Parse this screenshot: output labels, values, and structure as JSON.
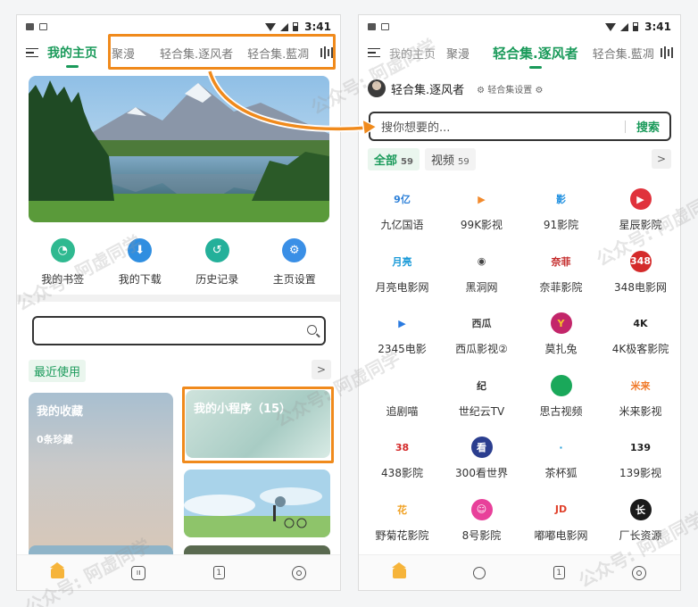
{
  "status": {
    "time": "3:41"
  },
  "nav": {
    "tabs_left": [
      "我的主页",
      "聚漫",
      "轻合集.逐风者",
      "轻合集.藍凋"
    ],
    "tabs_right": [
      "我的主页",
      "聚漫",
      "轻合集.逐风者",
      "轻合集.藍凋"
    ]
  },
  "home": {
    "quick_actions": [
      {
        "label": "我的书签",
        "icon": "bookmark-icon",
        "color": "#2fb990"
      },
      {
        "label": "我的下载",
        "icon": "download-icon",
        "color": "#2f8ee0"
      },
      {
        "label": "历史记录",
        "icon": "history-icon",
        "color": "#24b09a"
      },
      {
        "label": "主页设置",
        "icon": "gear-icon",
        "color": "#3a8fe6"
      }
    ],
    "recent_label": "最近使用",
    "cards": {
      "favorites_title": "我的收藏",
      "favorites_sub": "0条珍藏",
      "mini_title": "我的小程序（15）"
    }
  },
  "collection": {
    "name": "轻合集.逐风者",
    "settings": "⚙ 轻合集设置 ⚙",
    "search_placeholder": "搜你想要的...",
    "search_button": "搜索",
    "filters": [
      {
        "label": "全部",
        "count": "59"
      },
      {
        "label": "视频",
        "count": "59"
      }
    ],
    "sites": [
      {
        "name": "九亿国语",
        "logo": "9亿",
        "color": "#2b7fd8",
        "bg": "#fff"
      },
      {
        "name": "99K影视",
        "logo": "▶",
        "color": "#f28a2c",
        "bg": "#fff"
      },
      {
        "name": "91影院",
        "logo": "影",
        "color": "#1e8fe0",
        "bg": "#fff"
      },
      {
        "name": "星辰影院",
        "logo": "▶",
        "color": "#fff",
        "bg": "#e0323c"
      },
      {
        "name": "月亮电影网",
        "logo": "月亮",
        "color": "#1a9ad8",
        "bg": "#fff"
      },
      {
        "name": "黑洞网",
        "logo": "◉",
        "color": "#444",
        "bg": "#fff"
      },
      {
        "name": "奈菲影院",
        "logo": "奈菲",
        "color": "#c42a2a",
        "bg": "#fff"
      },
      {
        "name": "348电影网",
        "logo": "348",
        "color": "#fff",
        "bg": "#d42a2a"
      },
      {
        "name": "2345电影",
        "logo": "▶",
        "color": "#2a7ae0",
        "bg": "#fff"
      },
      {
        "name": "西瓜影视②",
        "logo": "西瓜",
        "color": "#444",
        "bg": "#fff"
      },
      {
        "name": "莫扎兔",
        "logo": "Y",
        "color": "#f5c32a",
        "bg": "#c3266a"
      },
      {
        "name": "4K极客影院",
        "logo": "4K",
        "color": "#222",
        "bg": "#fff"
      },
      {
        "name": "追剧喵",
        "logo": "",
        "color": "#fff",
        "bg": "#fff"
      },
      {
        "name": "世纪云TV",
        "logo": "纪",
        "color": "#333",
        "bg": "#fff"
      },
      {
        "name": "思古视频",
        "logo": "",
        "color": "#fff",
        "bg": "#1aa85a"
      },
      {
        "name": "米来影视",
        "logo": "米来",
        "color": "#f07a2a",
        "bg": "#fff"
      },
      {
        "name": "438影院",
        "logo": "38",
        "color": "#d42a2a",
        "bg": "#fff"
      },
      {
        "name": "300看世界",
        "logo": "看",
        "color": "#fff",
        "bg": "#2b3e8f"
      },
      {
        "name": "茶杯狐",
        "logo": "·",
        "color": "#1a9ad8",
        "bg": "#fff"
      },
      {
        "name": "139影视",
        "logo": "139",
        "color": "#222",
        "bg": "#fff"
      },
      {
        "name": "野菊花影院",
        "logo": "花",
        "color": "#f0a020",
        "bg": "#fff"
      },
      {
        "name": "8号影院",
        "logo": "☺",
        "color": "#fff",
        "bg": "#e8409a"
      },
      {
        "name": "嘟嘟电影网",
        "logo": "JD",
        "color": "#e0402a",
        "bg": "#fff"
      },
      {
        "name": "厂长资源",
        "logo": "长",
        "color": "#fff",
        "bg": "#1a1a1a"
      }
    ]
  },
  "watermark": "公众号: 阿虚同学"
}
